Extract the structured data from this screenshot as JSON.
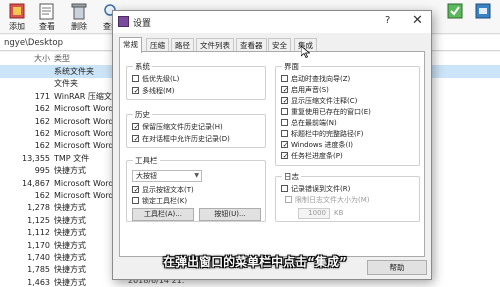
{
  "toolbar": {
    "items": [
      {
        "label": "添加",
        "icon": "add-archive-icon"
      },
      {
        "label": "查看",
        "icon": "view-icon"
      },
      {
        "label": "删除",
        "icon": "delete-icon"
      },
      {
        "label": "查找",
        "icon": "find-icon"
      }
    ]
  },
  "path": "ngye\\Desktop",
  "file_list": {
    "headers": {
      "size": "大小",
      "type": "类型"
    },
    "rows": [
      {
        "size": "",
        "type": "系统文件夹"
      },
      {
        "size": "",
        "type": "文件夹"
      },
      {
        "size": "171",
        "type": "WinRAR 压缩文件"
      },
      {
        "size": "162",
        "type": "Microsoft Word ..."
      },
      {
        "size": "162",
        "type": "Microsoft Word ..."
      },
      {
        "size": "162",
        "type": "Microsoft Word ..."
      },
      {
        "size": "162",
        "type": "Microsoft Word ..."
      },
      {
        "size": "13,355",
        "type": "TMP 文件"
      },
      {
        "size": "995",
        "type": "快捷方式"
      },
      {
        "size": "14,867",
        "type": "Microsoft Word ..."
      },
      {
        "size": "162",
        "type": "Microsoft Word ..."
      },
      {
        "size": "1,278",
        "type": "快捷方式"
      },
      {
        "size": "1,125",
        "type": "快捷方式"
      },
      {
        "size": "1,112",
        "type": "快捷方式"
      },
      {
        "size": "1,170",
        "type": "快捷方式"
      },
      {
        "size": "1,740",
        "type": "快捷方式"
      },
      {
        "size": "1,785",
        "type": "快捷方式"
      },
      {
        "size": "1,463",
        "type": "快捷方式"
      }
    ],
    "last_date": "2018/6/14 21:"
  },
  "dialog": {
    "title": "设置",
    "help": "?",
    "close": "✕",
    "tabs": [
      "常规",
      "压缩",
      "路径",
      "文件列表",
      "查看器",
      "安全",
      "集成"
    ],
    "active_tab": "常规",
    "system_group": {
      "title": "系统",
      "options": [
        {
          "label": "低优先级(L)",
          "checked": false
        },
        {
          "label": "多线程(M)",
          "checked": true
        }
      ]
    },
    "history_group": {
      "title": "历史",
      "options": [
        {
          "label": "保留压缩文件历史记录(H)",
          "checked": true
        },
        {
          "label": "在对话框中允许历史记录(D)",
          "checked": true
        }
      ]
    },
    "toolbar_group": {
      "title": "工具栏",
      "select_value": "大按钮",
      "options": [
        {
          "label": "显示按钮文本(T)",
          "checked": true
        },
        {
          "label": "锁定工具栏(K)",
          "checked": false
        }
      ],
      "toolbar_button": "工具栏(A)...",
      "buttons_button": "按钮(U)..."
    },
    "interface_group": {
      "title": "界面",
      "options": [
        {
          "label": "启动时查找向导(Z)",
          "checked": false
        },
        {
          "label": "启用声音(S)",
          "checked": true
        },
        {
          "label": "显示压缩文件注释(C)",
          "checked": true
        },
        {
          "label": "重复使用已存在的窗口(E)",
          "checked": false
        },
        {
          "label": "总在最前端(N)",
          "checked": false
        },
        {
          "label": "标题栏中的完整路径(F)",
          "checked": false
        },
        {
          "label": "Windows 进度条(I)",
          "checked": true
        },
        {
          "label": "任务栏进度条(P)",
          "checked": true
        }
      ]
    },
    "log_group": {
      "title": "日志",
      "options": [
        {
          "label": "记录错误到文件(R)",
          "checked": false
        },
        {
          "label": "限制日志文件大小为(M)",
          "checked": false
        }
      ],
      "size_value": "1000",
      "size_unit": "KB"
    },
    "buttons": {
      "help": "帮助"
    }
  },
  "subtitle": "在弹出窗口的菜单栏中点击“集成”"
}
